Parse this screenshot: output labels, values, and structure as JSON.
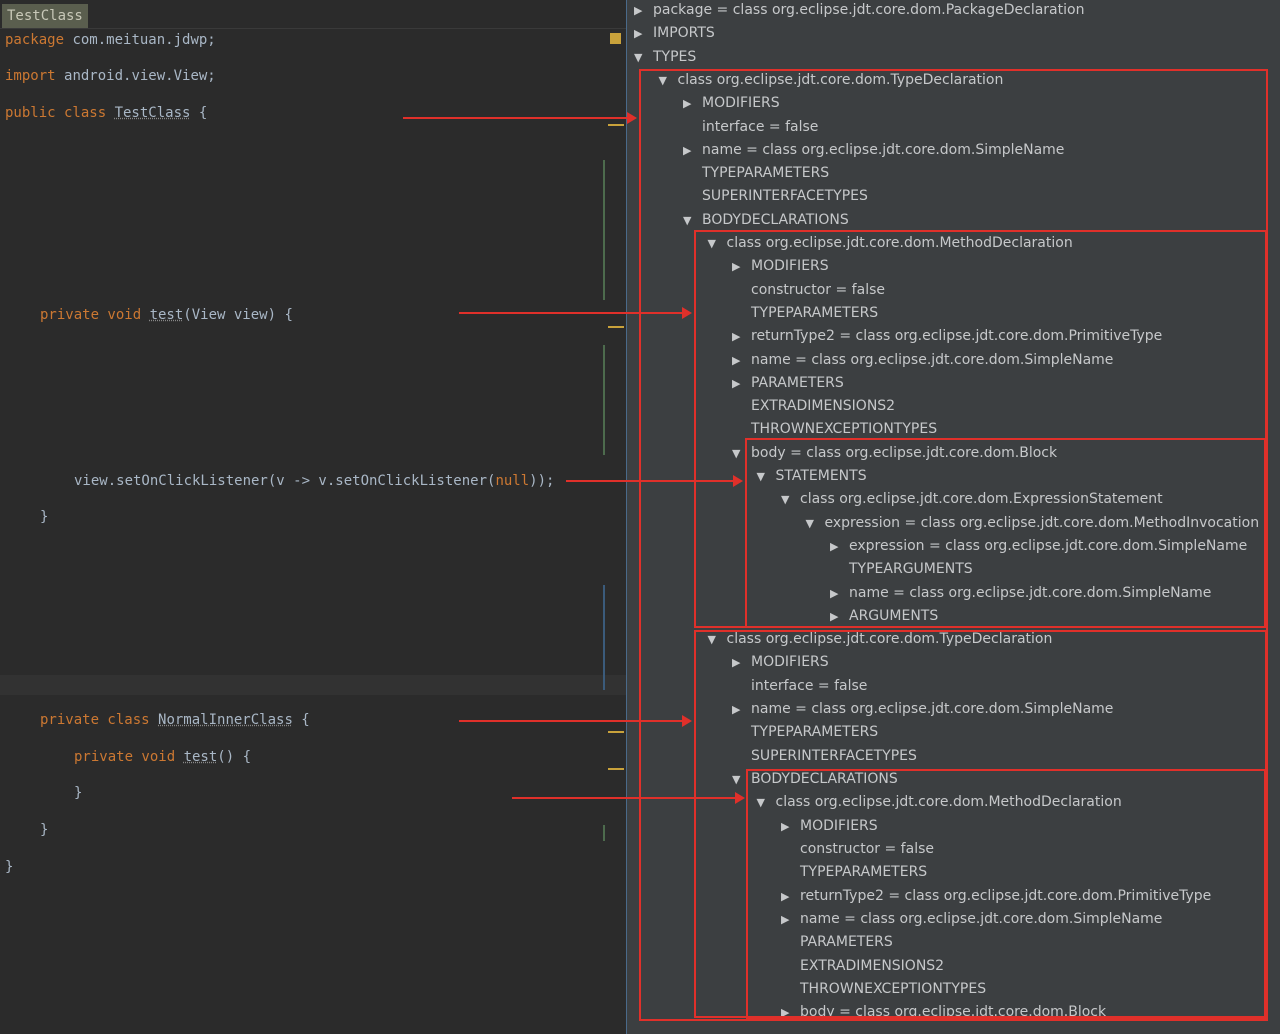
{
  "editor": {
    "tab": "TestClass",
    "lines": [
      {
        "kw": "package ",
        "rest": "com.meituan.jdwp;"
      },
      {
        "kw": "import ",
        "rest": "android.view.View;"
      },
      {
        "kw": "public class ",
        "name": "TestClass",
        "rest": " {"
      },
      {
        "kw": "private void ",
        "name": "test",
        "rest": "(View view) {"
      },
      {
        "pre": "view.setOnClickListener(v -> v.setOnClickListener(",
        "nl": "null",
        "rest": "));"
      },
      {
        "rest": "}"
      },
      {
        "kw": "private class ",
        "name": "NormalInnerClass",
        "rest": " {"
      },
      {
        "kw": "private void ",
        "name": "test",
        "rest": "() {"
      },
      {
        "rest": "}"
      },
      {
        "rest": "}"
      },
      {
        "rest": "}"
      }
    ]
  },
  "tree": [
    [
      0,
      "r",
      "package = class org.eclipse.jdt.core.dom.PackageDeclaration"
    ],
    [
      0,
      "r",
      "IMPORTS"
    ],
    [
      0,
      "d",
      "TYPES"
    ],
    [
      1,
      "d",
      "class org.eclipse.jdt.core.dom.TypeDeclaration"
    ],
    [
      2,
      "r",
      "MODIFIERS"
    ],
    [
      2,
      "",
      "interface = false"
    ],
    [
      2,
      "r",
      "name = class org.eclipse.jdt.core.dom.SimpleName"
    ],
    [
      2,
      "",
      "TYPEPARAMETERS"
    ],
    [
      2,
      "",
      "SUPERINTERFACETYPES"
    ],
    [
      2,
      "d",
      "BODYDECLARATIONS"
    ],
    [
      3,
      "d",
      "class org.eclipse.jdt.core.dom.MethodDeclaration"
    ],
    [
      4,
      "r",
      "MODIFIERS"
    ],
    [
      4,
      "",
      "constructor = false"
    ],
    [
      4,
      "",
      "TYPEPARAMETERS"
    ],
    [
      4,
      "r",
      "returnType2 = class org.eclipse.jdt.core.dom.PrimitiveType"
    ],
    [
      4,
      "r",
      "name = class org.eclipse.jdt.core.dom.SimpleName"
    ],
    [
      4,
      "r",
      "PARAMETERS"
    ],
    [
      4,
      "",
      "EXTRADIMENSIONS2"
    ],
    [
      4,
      "",
      "THROWNEXCEPTIONTYPES"
    ],
    [
      4,
      "d",
      "body = class org.eclipse.jdt.core.dom.Block"
    ],
    [
      5,
      "d",
      "STATEMENTS"
    ],
    [
      6,
      "d",
      "class org.eclipse.jdt.core.dom.ExpressionStatement"
    ],
    [
      7,
      "d",
      "expression = class org.eclipse.jdt.core.dom.MethodInvocation"
    ],
    [
      8,
      "r",
      "expression = class org.eclipse.jdt.core.dom.SimpleName"
    ],
    [
      8,
      "",
      "TYPEARGUMENTS"
    ],
    [
      8,
      "r",
      "name = class org.eclipse.jdt.core.dom.SimpleName"
    ],
    [
      8,
      "r",
      "ARGUMENTS"
    ],
    [
      3,
      "d",
      "class org.eclipse.jdt.core.dom.TypeDeclaration"
    ],
    [
      4,
      "r",
      "MODIFIERS"
    ],
    [
      4,
      "",
      "interface = false"
    ],
    [
      4,
      "r",
      "name = class org.eclipse.jdt.core.dom.SimpleName"
    ],
    [
      4,
      "",
      "TYPEPARAMETERS"
    ],
    [
      4,
      "",
      "SUPERINTERFACETYPES"
    ],
    [
      4,
      "d",
      "BODYDECLARATIONS"
    ],
    [
      5,
      "d",
      "class org.eclipse.jdt.core.dom.MethodDeclaration"
    ],
    [
      6,
      "r",
      "MODIFIERS"
    ],
    [
      6,
      "",
      "constructor = false"
    ],
    [
      6,
      "",
      "TYPEPARAMETERS"
    ],
    [
      6,
      "r",
      "returnType2 = class org.eclipse.jdt.core.dom.PrimitiveType"
    ],
    [
      6,
      "r",
      "name = class org.eclipse.jdt.core.dom.SimpleName"
    ],
    [
      6,
      "",
      "PARAMETERS"
    ],
    [
      6,
      "",
      "EXTRADIMENSIONS2"
    ],
    [
      6,
      "",
      "THROWNEXCEPTIONTYPES"
    ],
    [
      6,
      "r",
      "body = class org.eclipse.jdt.core.dom.Block"
    ]
  ],
  "colors": {
    "highlight": "#e0302a",
    "keyword": "#cc7832"
  }
}
